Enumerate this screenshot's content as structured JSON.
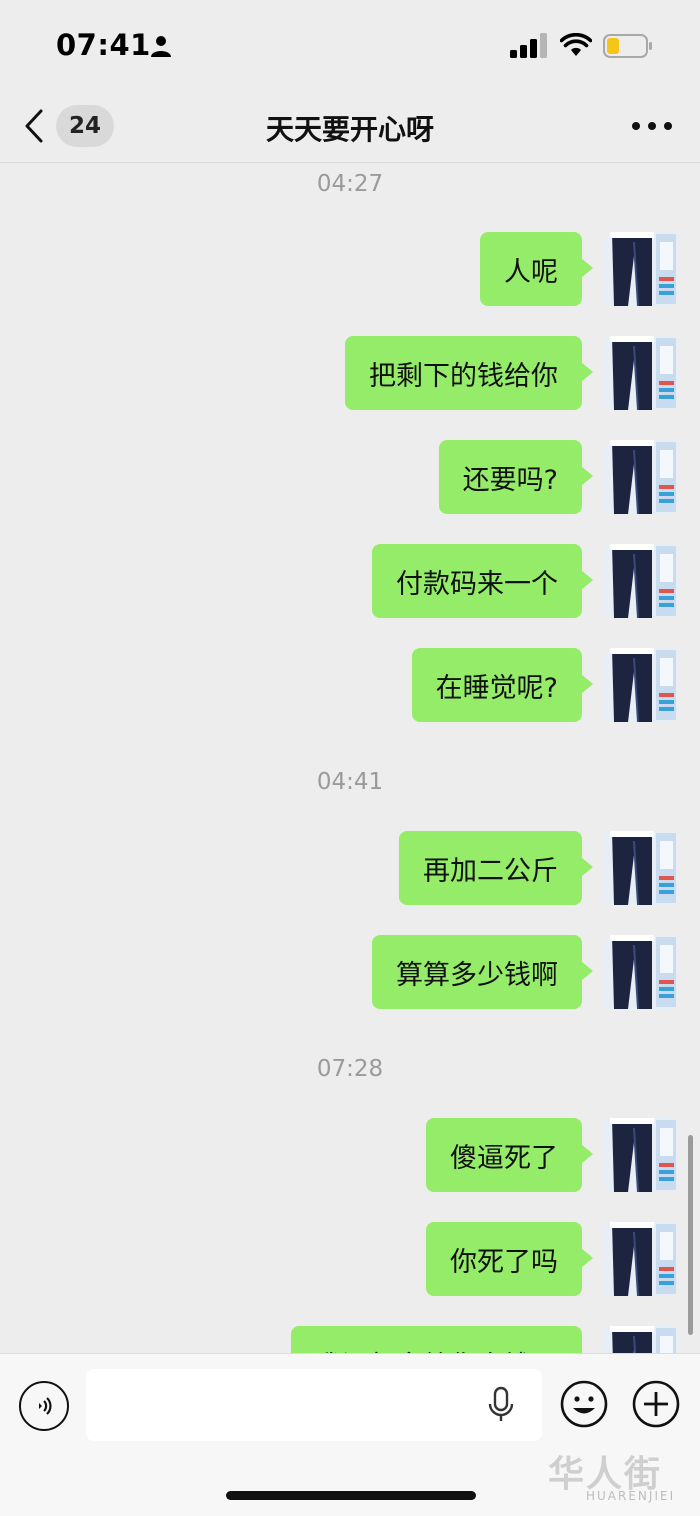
{
  "status_bar": {
    "time": "07:41",
    "icons": [
      "person-icon",
      "cellular-signal-icon",
      "wifi-icon",
      "battery-low-icon"
    ],
    "battery_color": "#f5c518"
  },
  "header": {
    "unread_count": "24",
    "title": "天天要开心呀",
    "back_icon": "chevron-left-icon",
    "more_icon": "more-dots-icon"
  },
  "colors": {
    "background": "#ededed",
    "bubble_sent": "#95ec69",
    "timestamp_text": "#9a9a9a"
  },
  "messages": [
    {
      "type": "time",
      "text": "04:27"
    },
    {
      "type": "sent",
      "text": "人呢"
    },
    {
      "type": "sent",
      "text": "把剩下的钱给你"
    },
    {
      "type": "sent",
      "text": "还要吗?"
    },
    {
      "type": "sent",
      "text": "付款码来一个"
    },
    {
      "type": "sent",
      "text": "在睡觉呢?"
    },
    {
      "type": "time",
      "text": "04:41"
    },
    {
      "type": "sent",
      "text": "再加二公斤"
    },
    {
      "type": "sent",
      "text": "算算多少钱啊"
    },
    {
      "type": "time",
      "text": "07:28"
    },
    {
      "type": "sent",
      "text": "傻逼死了"
    },
    {
      "type": "sent",
      "text": "你死了吗"
    },
    {
      "type": "sent",
      "text": "我还想多给你点钱呢"
    }
  ],
  "input_bar": {
    "text_value": "",
    "icons": [
      "voice-icon",
      "microphone-icon",
      "emoji-icon",
      "plus-icon"
    ]
  },
  "watermark": {
    "chinese": "华人街",
    "latin": "HUARENJIEI"
  }
}
